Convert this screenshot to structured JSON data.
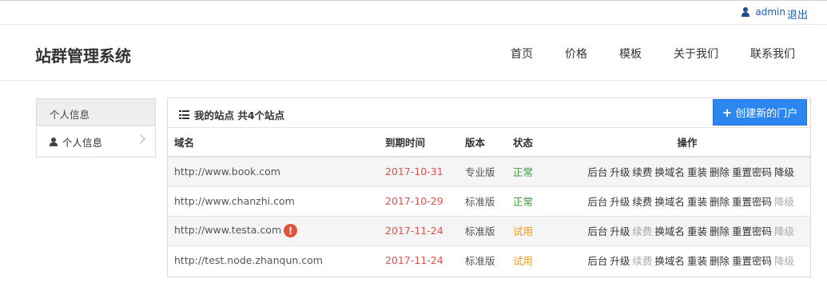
{
  "topbar": {
    "username": "admin",
    "logout": "退出"
  },
  "header": {
    "brand": "站群管理系统",
    "nav": [
      "首页",
      "价格",
      "模板",
      "关于我们",
      "联系我们"
    ]
  },
  "sidebar": {
    "title": "个人信息",
    "item": "个人信息"
  },
  "panel": {
    "title": "我的站点 共4个站点",
    "create_button": "创建新的门户",
    "columns": [
      "域名",
      "到期时间",
      "版本",
      "状态",
      "操作"
    ],
    "rows": [
      {
        "domain": "http://www.book.com",
        "warning": false,
        "date": "2017-10-31",
        "version": "专业版",
        "status": "正常",
        "ops": [
          [
            "后台",
            true
          ],
          [
            "升级",
            true
          ],
          [
            "续费",
            true
          ],
          [
            "换域名",
            true
          ],
          [
            "重装",
            true
          ],
          [
            "删除",
            true
          ],
          [
            "重置密码",
            true
          ],
          [
            "降级",
            true
          ]
        ]
      },
      {
        "domain": "http://www.chanzhi.com",
        "warning": false,
        "date": "2017-10-29",
        "version": "标准版",
        "status": "正常",
        "ops": [
          [
            "后台",
            true
          ],
          [
            "升级",
            true
          ],
          [
            "续费",
            true
          ],
          [
            "换域名",
            true
          ],
          [
            "重装",
            true
          ],
          [
            "删除",
            true
          ],
          [
            "重置密码",
            true
          ],
          [
            "降级",
            false
          ]
        ]
      },
      {
        "domain": "http://www.testa.com",
        "warning": true,
        "date": "2017-11-24",
        "version": "标准版",
        "status": "试用",
        "ops": [
          [
            "后台",
            true
          ],
          [
            "升级",
            true
          ],
          [
            "续费",
            false
          ],
          [
            "换域名",
            true
          ],
          [
            "重装",
            true
          ],
          [
            "删除",
            true
          ],
          [
            "重置密码",
            true
          ],
          [
            "降级",
            false
          ]
        ]
      },
      {
        "domain": "http://test.node.zhanqun.com",
        "warning": false,
        "date": "2017-11-24",
        "version": "标准版",
        "status": "试用",
        "ops": [
          [
            "后台",
            true
          ],
          [
            "升级",
            true
          ],
          [
            "续费",
            false
          ],
          [
            "换域名",
            true
          ],
          [
            "重装",
            true
          ],
          [
            "删除",
            true
          ],
          [
            "重置密码",
            true
          ],
          [
            "降级",
            false
          ]
        ]
      }
    ]
  },
  "colors": {
    "primary": "#2b86f0",
    "link": "#1d5fa8",
    "date": "#d9534f",
    "normal": "#3c9a3c",
    "trial": "#e89b1f",
    "warning": "#e0553a"
  },
  "icons": {
    "user": "user-icon",
    "list": "list-icon",
    "plus": "plus-icon",
    "warning": "exclamation-circle-icon",
    "chevron": "chevron-right-icon"
  }
}
